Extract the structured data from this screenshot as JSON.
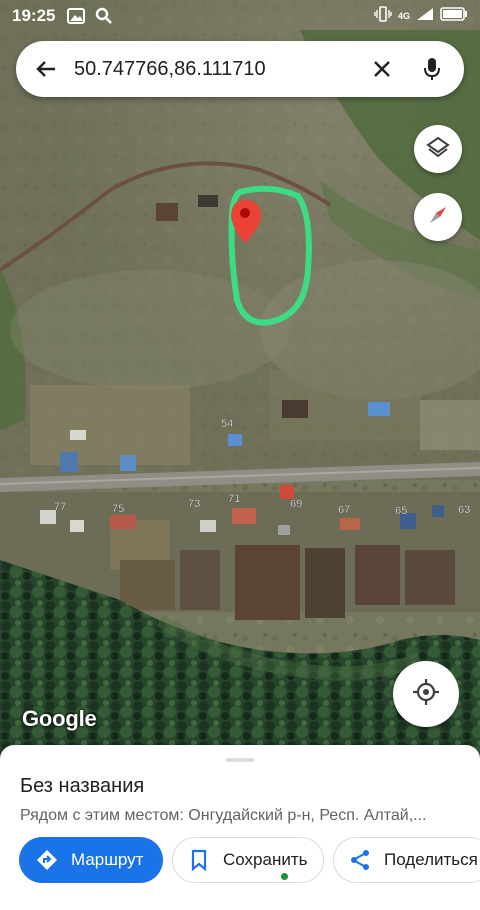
{
  "status_bar": {
    "time": "19:25",
    "network": "4G",
    "icons": [
      "gallery-icon",
      "search-icon",
      "vibrate-icon",
      "signal-icon",
      "battery-icon"
    ]
  },
  "search": {
    "query": "50.747766,86.111710",
    "icons": [
      "back-arrow-icon",
      "close-icon",
      "mic-icon"
    ]
  },
  "map": {
    "attribution": "Google",
    "house_numbers": [
      "54",
      "77",
      "75",
      "73",
      "71",
      "69",
      "67",
      "65",
      "63"
    ],
    "highlight_color": "#3ddc84",
    "pin_color": "#ea4335",
    "buttons": [
      "layers-icon",
      "compass-icon",
      "my-location-icon"
    ]
  },
  "place": {
    "title": "Без названия",
    "subtitle": "Рядом с этим местом: Онгудайский р-н, Респ. Алтай,..."
  },
  "actions": {
    "route": "Маршрут",
    "save": "Сохранить",
    "share": "Поделиться"
  },
  "colors": {
    "accent": "#1a73e8",
    "saved_dot": "#1e8e3e"
  }
}
